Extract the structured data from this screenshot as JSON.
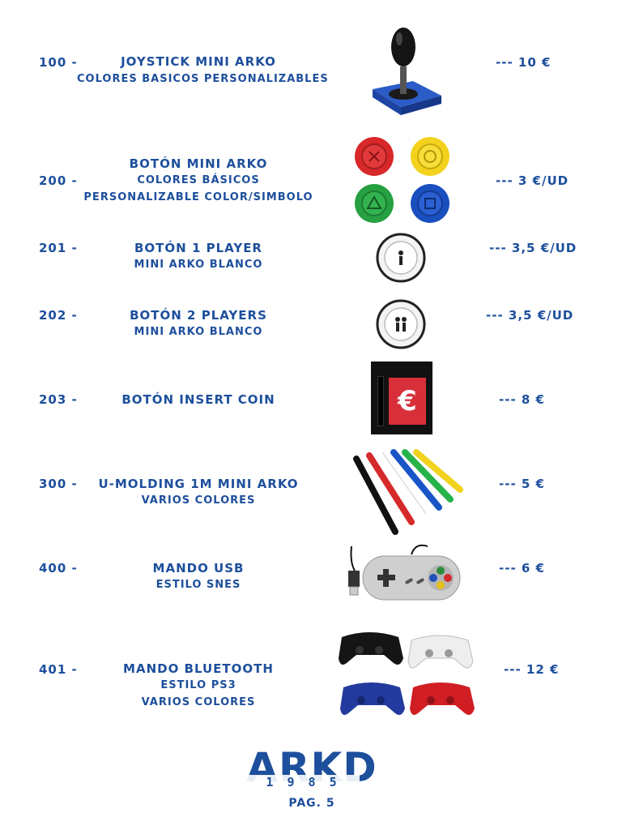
{
  "items": [
    {
      "code": "100 -",
      "title": "Joystick mini arko",
      "lines": [
        "Colores basicos personalizables"
      ],
      "price": "---   10 €"
    },
    {
      "code": "200 -",
      "title": "Botón mini arko",
      "lines": [
        "Colores básicos",
        "Personalizable color/simbolo"
      ],
      "price": "---   3 €/UD"
    },
    {
      "code": "201 -",
      "title": "Botón 1 player",
      "lines": [
        "Mini arko blanco"
      ],
      "price": "---   3,5 €/UD"
    },
    {
      "code": "202 -",
      "title": "Botón 2 players",
      "lines": [
        "Mini arko blanco"
      ],
      "price": "---   3,5 €/UD"
    },
    {
      "code": "203 -",
      "title": "Botón insert coin",
      "lines": [],
      "price": "---   8 €"
    },
    {
      "code": "300 -",
      "title": "U-molding 1m mini arko",
      "lines": [
        "Varios colores"
      ],
      "price": "---   5 €"
    },
    {
      "code": "400 -",
      "title": "Mando USB",
      "lines": [
        "Estilo SNES"
      ],
      "price": "---   6 €"
    },
    {
      "code": "401 -",
      "title": "Mando bluetooth",
      "lines": [
        "Estilo PS3",
        "Varios colores"
      ],
      "price": "---   12 €"
    }
  ],
  "footer": {
    "logo": "ARKD",
    "logo_sub": "1 9 8 5",
    "page": "Pag. 5"
  },
  "colors": {
    "brand": "#1d4f9c"
  },
  "coin_symbol": "€"
}
